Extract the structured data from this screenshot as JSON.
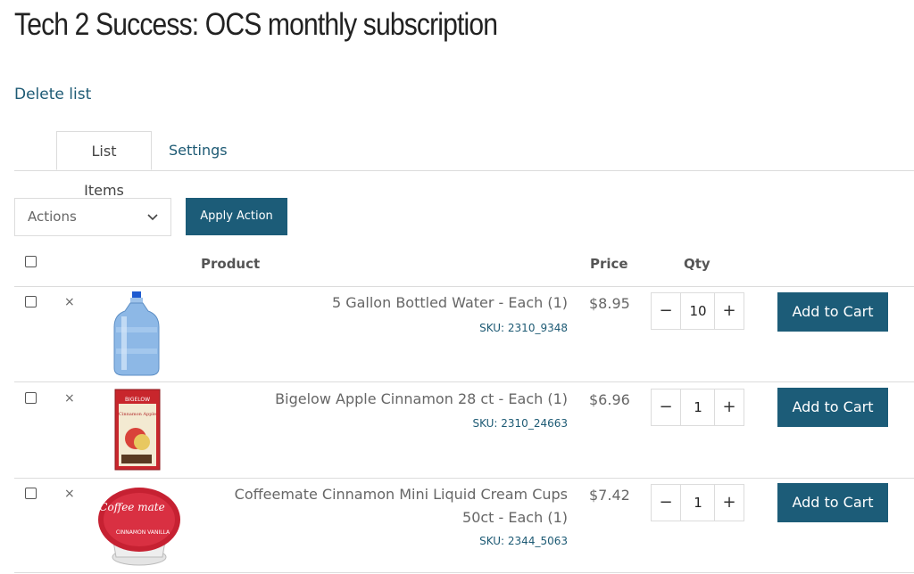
{
  "page": {
    "title": "Tech 2 Success: OCS monthly subscription",
    "delete_link": "Delete list"
  },
  "tabs": [
    {
      "label": "List Items",
      "active": true
    },
    {
      "label": "Settings",
      "active": false
    }
  ],
  "toolbar": {
    "actions_selected": "Actions",
    "apply_label": "Apply Action"
  },
  "table": {
    "headers": {
      "product": "Product",
      "price": "Price",
      "qty": "Qty"
    },
    "remove_symbol": "×",
    "add_to_cart_label": "Add to Cart",
    "minus_symbol": "−",
    "plus_symbol": "+",
    "rows": [
      {
        "name": "5 Gallon Bottled Water - Each (1)",
        "sku": "SKU: 2310_9348",
        "price": "$8.95",
        "qty": "10"
      },
      {
        "name": "Bigelow Apple Cinnamon 28 ct - Each (1)",
        "sku": "SKU: 2310_24663",
        "price": "$6.96",
        "qty": "1"
      },
      {
        "name_line1": "Coffeemate Cinnamon Mini Liquid Cream Cups",
        "name_line2": "50ct - Each (1)",
        "sku": "SKU: 2344_5063",
        "price": "$7.42",
        "qty": "1"
      }
    ]
  },
  "images": {
    "row0": {
      "label": "water-jug-image"
    },
    "row1": {
      "label": "tea-box-image",
      "brand_text": "BIGELOW",
      "product_text": "Cinnamon Apple"
    },
    "row2": {
      "label": "creamer-cup-image",
      "brand_text": "Coffee mate",
      "product_text": "CINNAMON VANILLA"
    }
  },
  "colors": {
    "accent": "#1c5c78",
    "link": "#1d5a74"
  }
}
